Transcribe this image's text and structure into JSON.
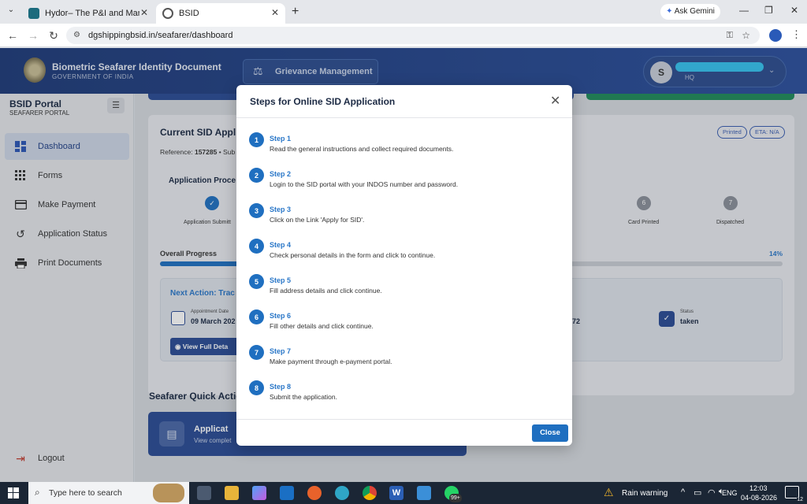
{
  "browser": {
    "tabs": [
      {
        "title": "Hydor– The P&I and Marine Lia"
      },
      {
        "title": "BSID"
      }
    ],
    "url": "dgshippingbsid.in/seafarer/dashboard",
    "ask_gemini": "Ask Gemini"
  },
  "header": {
    "title": "Biometric Seafarer Identity Document",
    "subtitle": "GOVERNMENT OF INDIA",
    "grievance": "Grievance Management",
    "user_initial": "S",
    "user_sub": "HQ"
  },
  "sidebar": {
    "portal_title": "BSID Portal",
    "portal_sub": "SEAFARER PORTAL",
    "items": [
      {
        "label": "Dashboard",
        "icon": "dashboard-icon"
      },
      {
        "label": "Forms",
        "icon": "grid-icon"
      },
      {
        "label": "Make Payment",
        "icon": "card-icon"
      },
      {
        "label": "Application Status",
        "icon": "history-icon"
      },
      {
        "label": "Print Documents",
        "icon": "printer-icon"
      }
    ],
    "logout": "Logout"
  },
  "main": {
    "current_title": "Current SID Appli",
    "reference_label": "Reference:",
    "reference_value": "157285",
    "reference_tail": "• Sub",
    "badge_printed": "Printed",
    "badge_eta": "ETA: N/A",
    "process_title": "Application Proce",
    "stages": [
      {
        "label": "Application Submitt",
        "num": "✓"
      },
      {
        "label": "Card Printed",
        "num": "6"
      },
      {
        "label": "Dispatched",
        "num": "7"
      }
    ],
    "overall_label": "Overall Progress",
    "overall_percent": "14%",
    "overall_value": 0.14,
    "next_action": "Next Action: Trac",
    "appt_label": "Appointment Date",
    "appt_value": "09 March 202",
    "mid_value": "72",
    "status_label": "Status",
    "status_value": "taken",
    "view_full": "View Full Deta",
    "quick_title": "Seafarer Quick Actio",
    "quick_card_title": "Applicat",
    "quick_card_sub": "View complet"
  },
  "modal": {
    "title": "Steps for Online SID Application",
    "close_label": "Close",
    "steps": [
      {
        "num": "1",
        "title": "Step 1",
        "desc": "Read the general instructions and collect required documents."
      },
      {
        "num": "2",
        "title": "Step 2",
        "desc": "Login to the SID portal with your INDOS number and password."
      },
      {
        "num": "3",
        "title": "Step 3",
        "desc": "Click on the Link 'Apply for SID'."
      },
      {
        "num": "4",
        "title": "Step 4",
        "desc": "Check personal details in the form and click to continue."
      },
      {
        "num": "5",
        "title": "Step 5",
        "desc": "Fill address details and click continue."
      },
      {
        "num": "6",
        "title": "Step 6",
        "desc": "Fill other details and click continue."
      },
      {
        "num": "7",
        "title": "Step 7",
        "desc": "Make payment through e-payment portal."
      },
      {
        "num": "8",
        "title": "Step 8",
        "desc": "Submit the application."
      }
    ]
  },
  "taskbar": {
    "search_placeholder": "Type here to search",
    "weather": "Rain warning",
    "lang": "ENG",
    "time": "12:03",
    "date": "04-08-2026",
    "whatsapp_badge": "99+",
    "notif_count": "12"
  },
  "colors": {
    "brand_blue": "#1f3f86",
    "step_blue": "#1f6fc0",
    "close_button": "#1f6fc0"
  }
}
